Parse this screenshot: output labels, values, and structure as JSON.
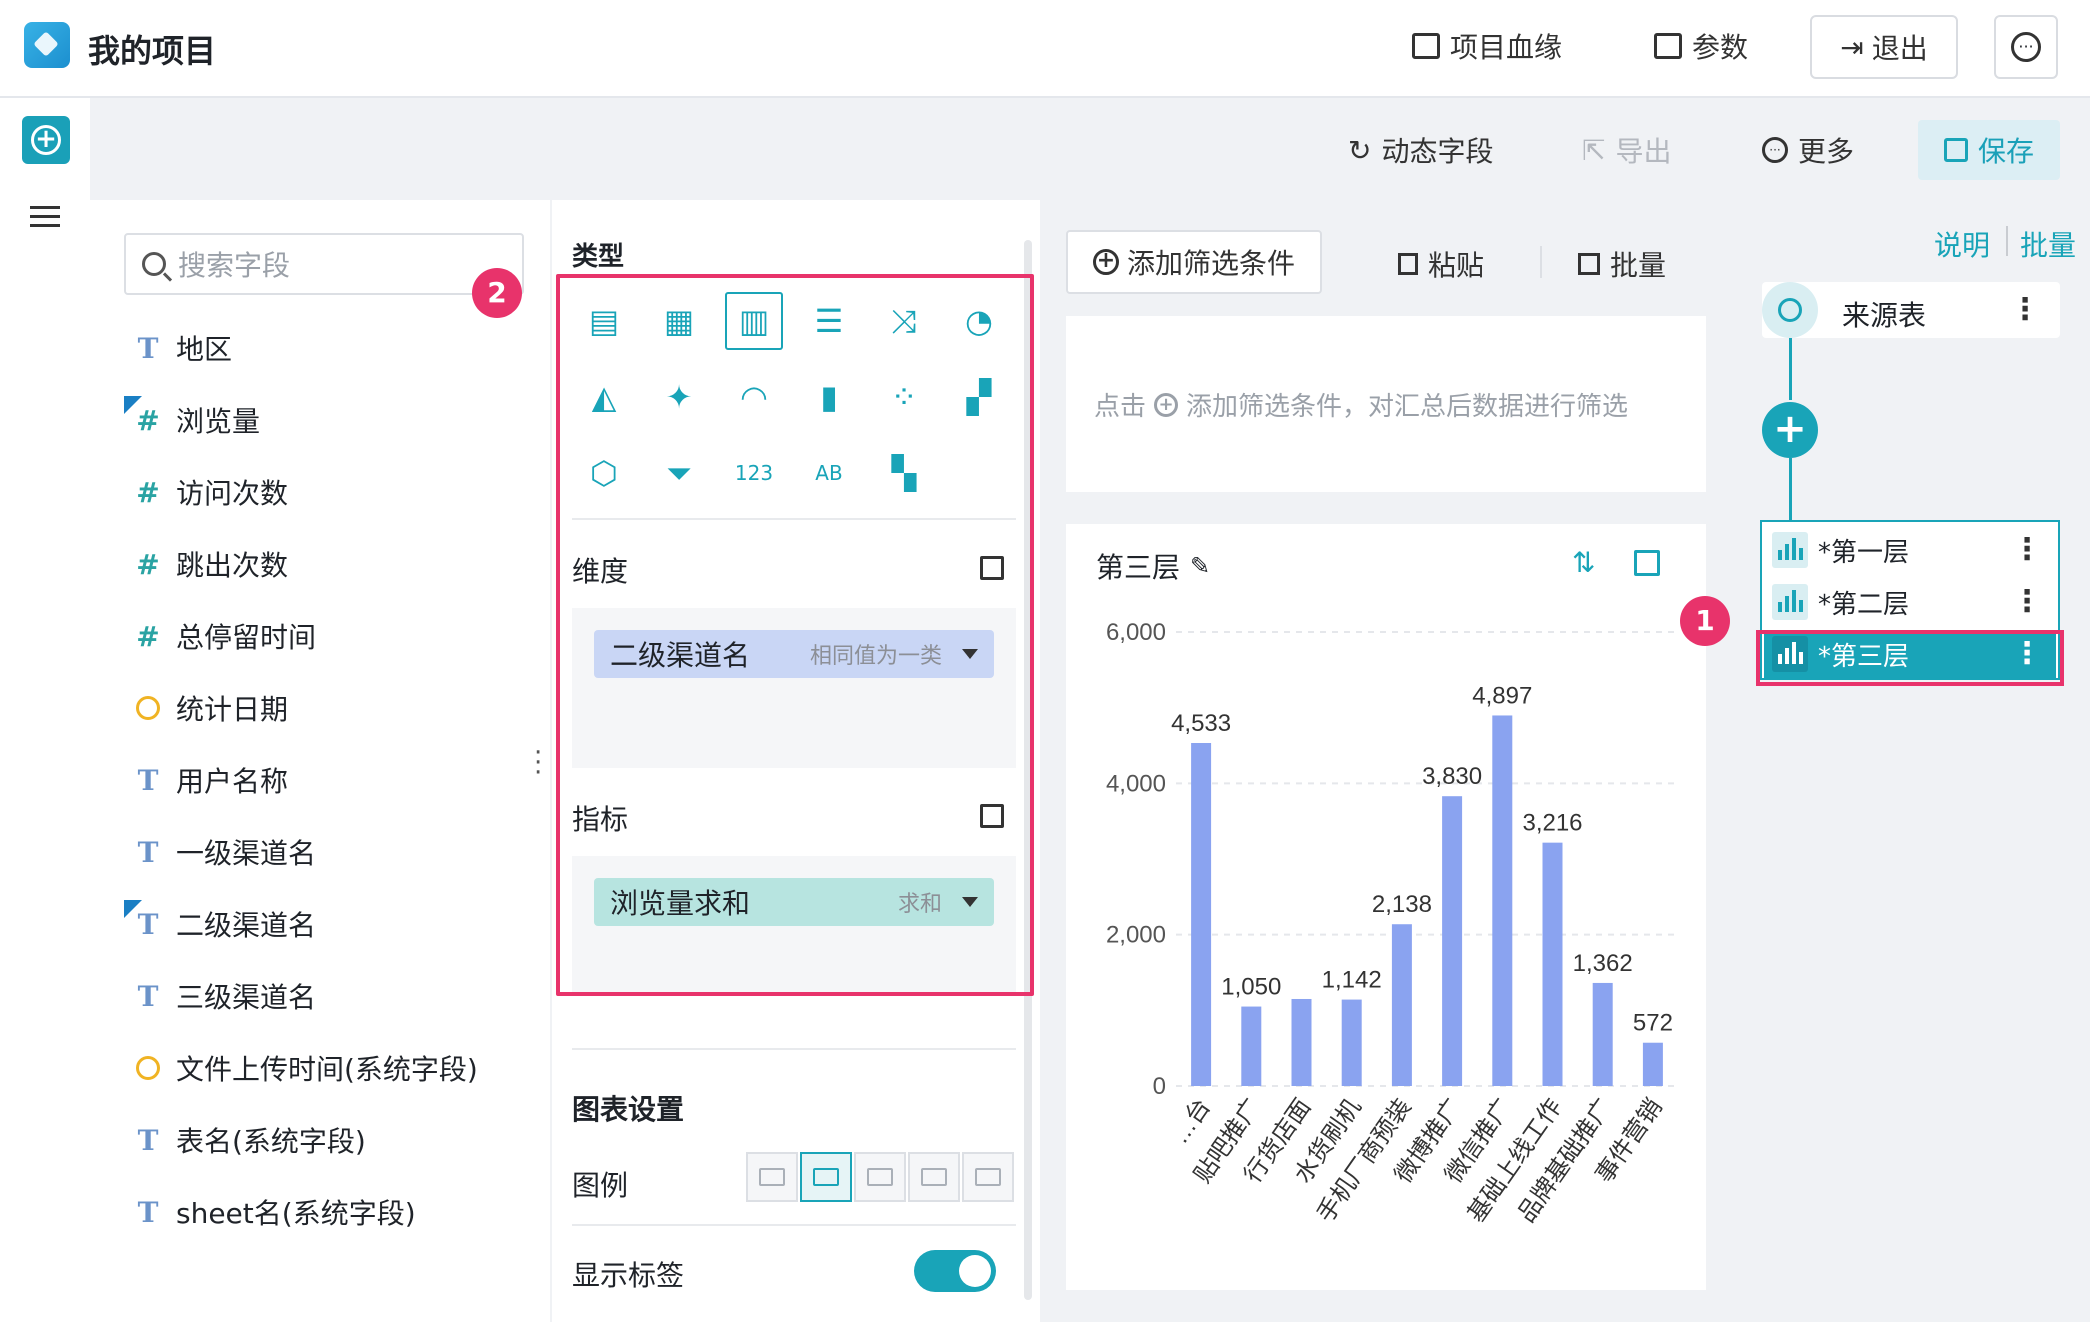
{
  "header": {
    "title": "我的项目",
    "lineage_label": "项目血缘",
    "params_label": "参数",
    "exit_label": "退出",
    "more_glyph": "···"
  },
  "toolbar": {
    "dynamic_field_label": "动态字段",
    "export_label": "导出",
    "more_label": "更多",
    "save_label": "保存"
  },
  "fields": {
    "search_placeholder": "搜索字段",
    "items": [
      {
        "type": "text",
        "label": "地区",
        "checked": false
      },
      {
        "type": "number",
        "label": "浏览量",
        "checked": true
      },
      {
        "type": "number",
        "label": "访问次数",
        "checked": false
      },
      {
        "type": "number",
        "label": "跳出次数",
        "checked": false
      },
      {
        "type": "number",
        "label": "总停留时间",
        "checked": false
      },
      {
        "type": "date",
        "label": "统计日期",
        "checked": false
      },
      {
        "type": "text",
        "label": "用户名称",
        "checked": false
      },
      {
        "type": "text",
        "label": "一级渠道名",
        "checked": false
      },
      {
        "type": "text",
        "label": "二级渠道名",
        "checked": true
      },
      {
        "type": "text",
        "label": "三级渠道名",
        "checked": false
      },
      {
        "type": "date",
        "label": "文件上传时间(系统字段)",
        "checked": false
      },
      {
        "type": "text",
        "label": "表名(系统字段)",
        "checked": false
      },
      {
        "type": "text",
        "label": "sheet名(系统字段)",
        "checked": false
      }
    ]
  },
  "config": {
    "type_label": "类型",
    "badge_2": "2",
    "chart_types": [
      "table-icon",
      "cross-table-icon",
      "bar-chart-icon",
      "horizontal-bar-icon",
      "combo-line-icon",
      "pie-chart-icon",
      "area-chart-icon",
      "map-icon",
      "gauge-icon",
      "stacked-bar-icon",
      "scatter-icon",
      "treemap-icon",
      "radar-icon",
      "funnel-icon",
      "kpi-number-icon",
      "word-cloud-icon",
      "heatmap-icon"
    ],
    "selected_chart_type": "bar-chart-icon",
    "dimension_label": "维度",
    "dimension_pill": {
      "label": "二级渠道名",
      "sub": "相同值为一类"
    },
    "metric_label": "指标",
    "metric_pill": {
      "label": "浏览量求和",
      "sub": "求和"
    },
    "chart_settings_label": "图表设置",
    "legend_label": "图例",
    "show_label_label": "显示标签",
    "show_label_on": true
  },
  "filter": {
    "add_label": "添加筛选条件",
    "paste_label": "粘贴",
    "batch_label": "批量",
    "hint_prefix": "点击",
    "hint_text": "添加筛选条件，对汇总后数据进行筛选"
  },
  "chart_card": {
    "title": "第三层"
  },
  "chart_data": {
    "type": "bar",
    "categories": [
      "…台",
      "贴吧推广",
      "行货店面",
      "水货刷机",
      "手机厂商预装",
      "微博推广",
      "微信推广",
      "基础上线工作",
      "品牌基础推广",
      "事件营销"
    ],
    "values": [
      4533,
      1050,
      1150,
      1142,
      2138,
      3830,
      4897,
      3216,
      1362,
      572
    ],
    "data_labels": [
      "4,533",
      "1,050",
      "",
      "1,142",
      "2,138",
      "3,830",
      "4,897",
      "3,216",
      "1,362",
      "572"
    ],
    "yticks": [
      "0",
      "2,000",
      "4,000",
      "6,000"
    ],
    "ylim": [
      0,
      6000
    ],
    "color": "#8aa3f0",
    "grid": true
  },
  "flow": {
    "explain_label": "说明",
    "bulk_label": "批量",
    "source_label": "来源表",
    "layers": [
      {
        "label": "*第一层",
        "active": false
      },
      {
        "label": "*第二层",
        "active": false
      },
      {
        "label": "*第三层",
        "active": true
      }
    ],
    "badge_1": "1"
  },
  "colors": {
    "accent": "#19a4b8",
    "highlight": "#e8336b",
    "dimension_pill": "#c9d6f5",
    "metric_pill": "#b7e4e0"
  }
}
